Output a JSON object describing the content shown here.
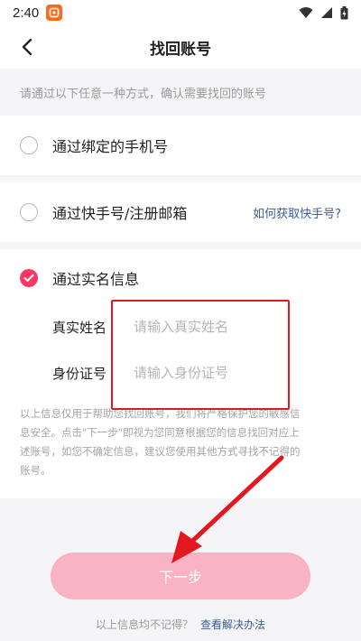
{
  "status_bar": {
    "time": "2:40",
    "app_badge_icon": "app-badge-icon",
    "icons": [
      "wifi-icon",
      "signal-icon",
      "battery-icon"
    ]
  },
  "nav": {
    "title": "找回账号",
    "back_icon": "chevron-left-icon"
  },
  "hint": "请通过以下任意一种方式，确认需要找回的账号",
  "options": [
    {
      "label": "通过绑定的手机号",
      "checked": false
    },
    {
      "label": "通过快手号/注册邮箱",
      "checked": false,
      "link": "如何获取快手号?"
    },
    {
      "label": "通过实名信息",
      "checked": true
    }
  ],
  "form": {
    "name_label": "真实姓名",
    "name_placeholder": "请输入真实姓名",
    "id_label": "身份证号",
    "id_placeholder": "请输入身份证号"
  },
  "notice_lines": [
    "以上信息仅用于帮助您找回账号，我们将严格保护您的敏感信",
    "息安全。点击\"下一步\"即视为您同意根据您的信息找回对应上",
    "述账号，如您不确定信息，建议您使用其他方式寻找不记得的",
    "账号。"
  ],
  "next_button": "下一步",
  "footer": {
    "text": "以上信息均不记得？",
    "link": "查看解决办法"
  },
  "colors": {
    "accent": "#fe3666",
    "button_disabled": "#f9b3c4",
    "link": "#3a5d9a",
    "annotation_red": "#e3181e"
  }
}
